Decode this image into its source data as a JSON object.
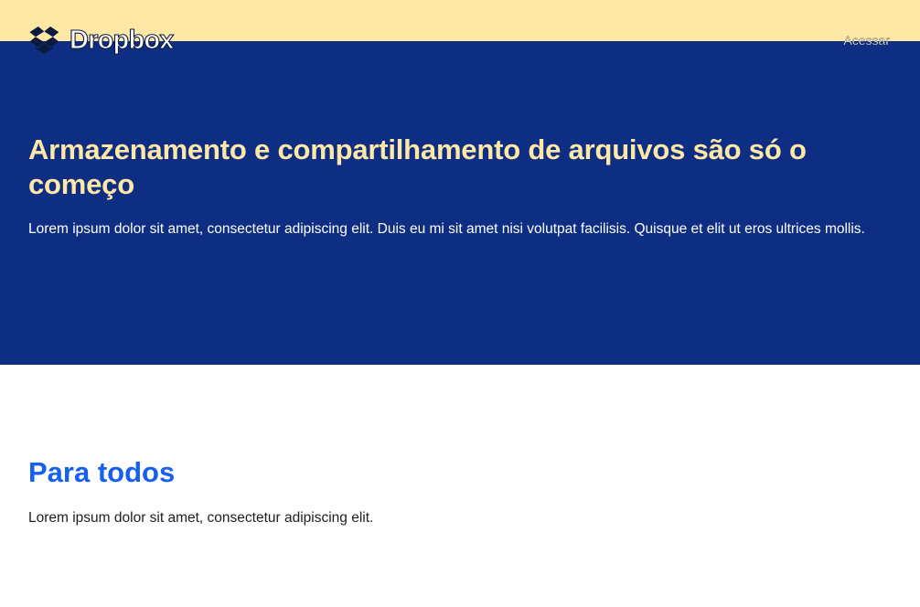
{
  "header": {
    "brand": "Dropbox",
    "logo_icon": "dropbox-box-icon",
    "nav_link": "Acessar"
  },
  "hero": {
    "title": "Armazenamento e compartilhamento de arquivos são só o começo",
    "text": "Lorem ipsum dolor sit amet, consectetur adipiscing elit. Duis eu mi sit amet nisi volutpat facilisis. Quisque et elit ut eros ultrices mollis."
  },
  "section": {
    "title": "Para todos",
    "text": "Lorem ipsum dolor sit amet, consectetur adipiscing elit."
  },
  "colors": {
    "topbar": "#ffe7a5",
    "hero_bg": "#0d2e82",
    "hero_title": "#ffe7a5",
    "section_title": "#1660f0"
  }
}
